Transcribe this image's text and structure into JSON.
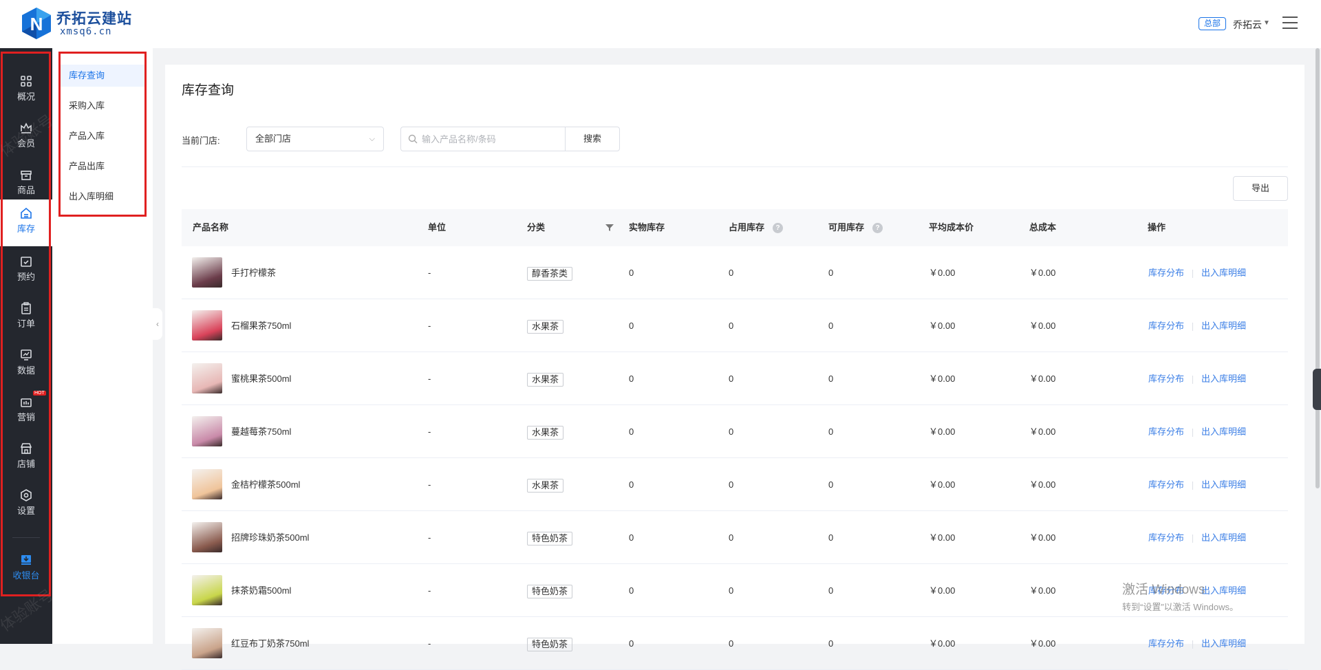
{
  "header": {
    "logo_title": "乔拓云建站",
    "logo_sub": "xmsq6.cn",
    "hq_badge": "总部",
    "user_name": "乔拓云"
  },
  "rail": {
    "items": [
      {
        "label": "概况",
        "icon": "overview-grid-icon"
      },
      {
        "label": "会员",
        "icon": "crown-icon"
      },
      {
        "label": "商品",
        "icon": "box-icon"
      },
      {
        "label": "库存",
        "icon": "inventory-icon"
      },
      {
        "label": "预约",
        "icon": "calendar-check-icon"
      },
      {
        "label": "订单",
        "icon": "clipboard-icon"
      },
      {
        "label": "数据",
        "icon": "chart-monitor-icon"
      },
      {
        "label": "营销",
        "icon": "marketing-icon"
      },
      {
        "label": "店铺",
        "icon": "shop-icon"
      },
      {
        "label": "设置",
        "icon": "settings-icon"
      },
      {
        "label": "收银台",
        "icon": "cashier-icon"
      }
    ],
    "hot_badge": "HOT"
  },
  "submenu": {
    "items": [
      "库存查询",
      "采购入库",
      "产品入库",
      "产品出库",
      "出入库明细"
    ]
  },
  "main": {
    "title": "库存查询",
    "store_label": "当前门店:",
    "store_value": "全部门店",
    "search_placeholder": "输入产品名称/条码",
    "search_button": "搜索",
    "export_button": "导出"
  },
  "table": {
    "headers": [
      "产品名称",
      "单位",
      "分类",
      "实物库存",
      "占用库存",
      "可用库存",
      "平均成本价",
      "总成本",
      "操作"
    ],
    "action_1": "库存分布",
    "action_2": "出入库明细",
    "rows": [
      {
        "name": "手打柠檬茶",
        "unit": "-",
        "category": "醇香茶类",
        "physical": "0",
        "occupied": "0",
        "available": "0",
        "avg_cost": "￥0.00",
        "total_cost": "￥0.00",
        "thumb": "#6b3c4a"
      },
      {
        "name": "石榴果茶750ml",
        "unit": "-",
        "category": "水果茶",
        "physical": "0",
        "occupied": "0",
        "available": "0",
        "avg_cost": "￥0.00",
        "total_cost": "￥0.00",
        "thumb": "#d9435a"
      },
      {
        "name": "蜜桃果茶500ml",
        "unit": "-",
        "category": "水果茶",
        "physical": "0",
        "occupied": "0",
        "available": "0",
        "avg_cost": "￥0.00",
        "total_cost": "￥0.00",
        "thumb": "#e7b7b5"
      },
      {
        "name": "蔓越莓茶750ml",
        "unit": "-",
        "category": "水果茶",
        "physical": "0",
        "occupied": "0",
        "available": "0",
        "avg_cost": "￥0.00",
        "total_cost": "￥0.00",
        "thumb": "#c98aa9"
      },
      {
        "name": "金桔柠檬茶500ml",
        "unit": "-",
        "category": "水果茶",
        "physical": "0",
        "occupied": "0",
        "available": "0",
        "avg_cost": "￥0.00",
        "total_cost": "￥0.00",
        "thumb": "#f0c49a"
      },
      {
        "name": "招牌珍珠奶茶500ml",
        "unit": "-",
        "category": "特色奶茶",
        "physical": "0",
        "occupied": "0",
        "available": "0",
        "avg_cost": "￥0.00",
        "total_cost": "￥0.00",
        "thumb": "#8a5b4e"
      },
      {
        "name": "抹茶奶霜500ml",
        "unit": "-",
        "category": "特色奶茶",
        "physical": "0",
        "occupied": "0",
        "available": "0",
        "avg_cost": "￥0.00",
        "total_cost": "￥0.00",
        "thumb": "#c8d64a"
      },
      {
        "name": "红豆布丁奶茶750ml",
        "unit": "-",
        "category": "特色奶茶",
        "physical": "0",
        "occupied": "0",
        "available": "0",
        "avg_cost": "￥0.00",
        "total_cost": "￥0.00",
        "thumb": "#c9a38a"
      }
    ]
  },
  "watermark_text": "体验账号",
  "windows_activation": {
    "line1": "激活 Windows",
    "line2": "转到“设置”以激活 Windows。"
  }
}
